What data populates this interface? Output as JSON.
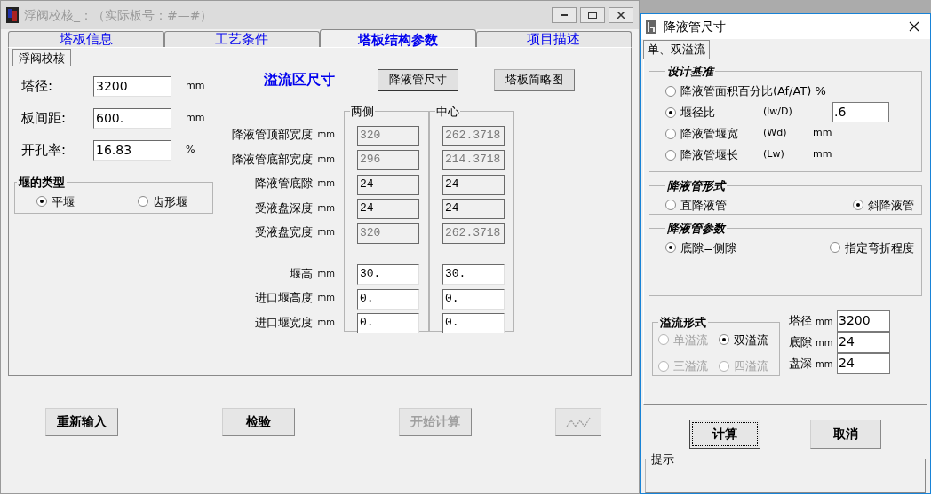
{
  "main_window": {
    "title": "浮阀校核_：（实际板号：#—#）",
    "tabs": [
      {
        "label": "塔板信息",
        "selected": false
      },
      {
        "label": "工艺条件",
        "selected": false
      },
      {
        "label": "塔板结构参数",
        "selected": true
      },
      {
        "label": "项目描述",
        "selected": false
      }
    ],
    "subtabs": [
      {
        "label": "浮阀校核",
        "selected": true
      }
    ],
    "fields": [
      {
        "label": "塔径:",
        "value": "3200",
        "unit": "mm"
      },
      {
        "label": "板间距:",
        "value": "600.",
        "unit": "mm"
      },
      {
        "label": "开孔率:",
        "value": "16.83",
        "unit": "%"
      }
    ],
    "weir_type": {
      "title": "堰的类型",
      "options": [
        {
          "label": "平堰",
          "selected": true
        },
        {
          "label": "齿形堰",
          "selected": false
        }
      ]
    },
    "section_title": "溢流区尺寸",
    "top_buttons": [
      {
        "label": "降液管尺寸",
        "focused": true
      },
      {
        "label": "塔板简略图",
        "focused": false
      }
    ],
    "columns": [
      "两侧",
      "中心"
    ],
    "row_groups": [
      [
        {
          "label": "降液管顶部宽度",
          "unit": "mm",
          "cells": [
            {
              "value": "320",
              "disabled": true,
              "readonly": true
            },
            {
              "value": "262.3718",
              "disabled": true,
              "readonly": true
            }
          ]
        },
        {
          "label": "降液管底部宽度",
          "unit": "mm",
          "cells": [
            {
              "value": "296",
              "disabled": true,
              "readonly": true
            },
            {
              "value": "214.3718",
              "disabled": true,
              "readonly": true
            }
          ]
        },
        {
          "label": "降液管底隙",
          "unit": "mm",
          "cells": [
            {
              "value": "24",
              "disabled": false,
              "readonly": true
            },
            {
              "value": "24",
              "disabled": false,
              "readonly": true
            }
          ]
        },
        {
          "label": "受液盘深度",
          "unit": "mm",
          "cells": [
            {
              "value": "24",
              "disabled": false,
              "readonly": true
            },
            {
              "value": "24",
              "disabled": false,
              "readonly": true
            }
          ]
        },
        {
          "label": "受液盘宽度",
          "unit": "mm",
          "cells": [
            {
              "value": "320",
              "disabled": true,
              "readonly": true
            },
            {
              "value": "262.3718",
              "disabled": true,
              "readonly": true
            }
          ]
        }
      ],
      [
        {
          "label": "堰高",
          "unit": "mm",
          "cells": [
            {
              "value": "30.",
              "disabled": false,
              "readonly": false
            },
            {
              "value": "30.",
              "disabled": false,
              "readonly": false
            }
          ]
        },
        {
          "label": "进口堰高度",
          "unit": "mm",
          "cells": [
            {
              "value": "0.",
              "disabled": false,
              "readonly": false
            },
            {
              "value": "0.",
              "disabled": false,
              "readonly": false
            }
          ]
        },
        {
          "label": "进口堰宽度",
          "unit": "mm",
          "cells": [
            {
              "value": "0.",
              "disabled": false,
              "readonly": false
            },
            {
              "value": "0.",
              "disabled": false,
              "readonly": false
            }
          ]
        }
      ]
    ],
    "bottom_buttons": [
      {
        "kind": "text",
        "label": "重新输入",
        "disabled": false
      },
      {
        "kind": "text",
        "label": "检验",
        "disabled": false
      },
      {
        "kind": "text",
        "label": "开始计算",
        "disabled": true
      },
      {
        "kind": "icon",
        "disabled": true
      }
    ]
  },
  "dialog": {
    "title": "降液管尺寸",
    "tabs": [
      {
        "label": "单、双溢流",
        "selected": true
      }
    ],
    "design_basis": {
      "title": "设计基准",
      "options": [
        {
          "label": "降液管面积百分比(Af/AT) %",
          "selected": false
        },
        {
          "label": "堰径比",
          "symbol": "(lw/D)",
          "value": ".6",
          "selected": true
        },
        {
          "label": "降液管堰宽",
          "symbol": "(Wd)",
          "unit": "mm",
          "selected": false
        },
        {
          "label": "降液管堰长",
          "symbol": "(Lw)",
          "unit": "mm",
          "selected": false
        }
      ]
    },
    "downcomer_form": {
      "title": "降液管形式",
      "options": [
        {
          "label": "直降液管",
          "selected": false
        },
        {
          "label": "斜降液管",
          "selected": true
        }
      ]
    },
    "downcomer_params": {
      "title": "降液管参数",
      "options": [
        {
          "label": "底隙=侧隙",
          "selected": true
        },
        {
          "label": "指定弯折程度",
          "selected": false
        }
      ]
    },
    "overflow_form": {
      "title": "溢流形式",
      "options": [
        {
          "label": "单溢流",
          "selected": false,
          "disabled": true
        },
        {
          "label": "双溢流",
          "selected": true,
          "disabled": false
        },
        {
          "label": "三溢流",
          "selected": false,
          "disabled": true
        },
        {
          "label": "四溢流",
          "selected": false,
          "disabled": true
        }
      ]
    },
    "fields": [
      {
        "label": "塔径",
        "unit": "mm",
        "value": "3200"
      },
      {
        "label": "底隙",
        "unit": "mm",
        "value": "24"
      },
      {
        "label": "盘深",
        "unit": "mm",
        "value": "24"
      }
    ],
    "buttons": [
      {
        "label": "计算",
        "focused": true
      },
      {
        "label": "取消",
        "focused": false
      }
    ],
    "hint": {
      "title": "提示"
    }
  }
}
